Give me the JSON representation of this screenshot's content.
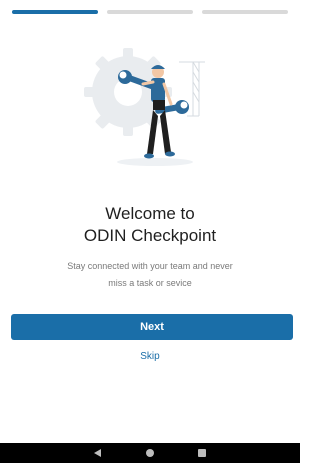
{
  "onboarding": {
    "steps_total": 3,
    "current_step": 1,
    "title_line1": "Welcome to",
    "title_line2": "ODIN Checkpoint",
    "subtitle_line1": "Stay connected with your team and never",
    "subtitle_line2": "miss a task or sevice",
    "next_label": "Next",
    "skip_label": "Skip"
  },
  "illustration": {
    "name": "worker-with-wrench-illustration",
    "icon": "worker-wrench-gear"
  },
  "navbar": {
    "icons": [
      "back-icon",
      "home-icon",
      "recents-icon"
    ]
  },
  "colors": {
    "accent": "#1a6ea8",
    "progress_inactive": "#d9d9d9",
    "title": "#1f1f1f",
    "subtitle": "#7a7a7a",
    "navbar": "#000000"
  }
}
